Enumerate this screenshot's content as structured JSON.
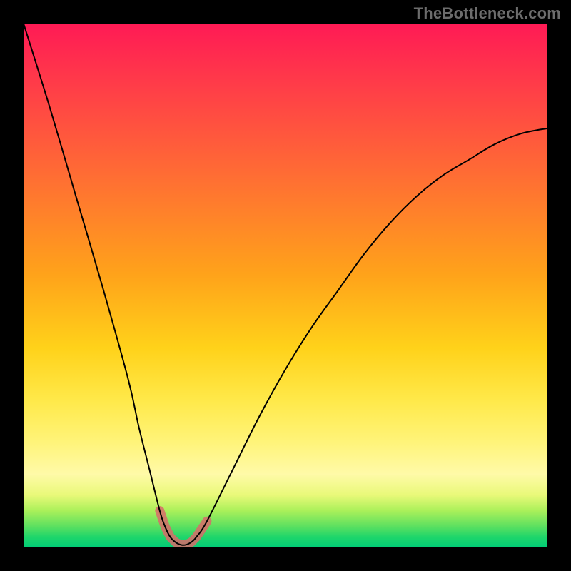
{
  "watermark": "TheBottleneck.com",
  "chart_data": {
    "type": "line",
    "title": "",
    "xlabel": "",
    "ylabel": "",
    "xlim": [
      0,
      100
    ],
    "ylim": [
      0,
      100
    ],
    "x": [
      0,
      5,
      10,
      15,
      20,
      22,
      24,
      26,
      27,
      28,
      29,
      30,
      31,
      32,
      33,
      35,
      40,
      45,
      50,
      55,
      60,
      65,
      70,
      75,
      80,
      85,
      90,
      95,
      100
    ],
    "values": [
      100,
      84,
      67,
      50,
      32,
      23,
      15,
      7,
      4,
      2,
      1,
      0.5,
      0.5,
      1,
      2,
      5,
      15,
      25,
      34,
      42,
      49,
      56,
      62,
      67,
      71,
      74,
      77,
      79,
      80
    ],
    "highlight_range_x": [
      26,
      35
    ],
    "notes": "Values are approximate readings of the black curve relative to plot height (0 = bottom/green, 100 = top/red). The pink segment highlights the valley of the curve between roughly x=26 and x=35."
  },
  "colors": {
    "curve": "#000000",
    "highlight": "#d96a6a",
    "gradient_top": "#ff1a55",
    "gradient_bottom": "#00cc77"
  }
}
